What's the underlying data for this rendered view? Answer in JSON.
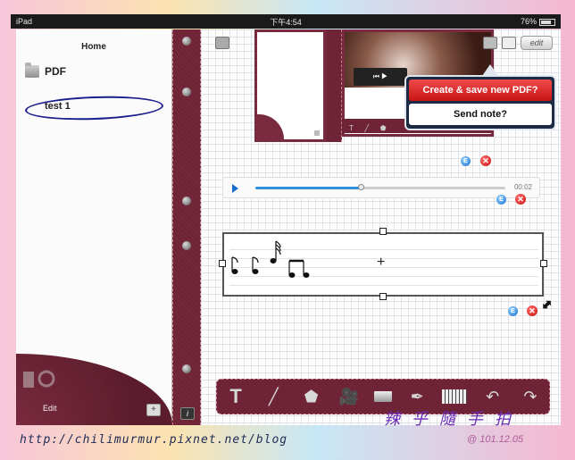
{
  "statusbar": {
    "device": "iPad",
    "time": "下午4:54",
    "battery": "76%"
  },
  "sidebar": {
    "title": "Home",
    "items": [
      {
        "label": "PDF",
        "type": "folder"
      },
      {
        "label": "test 1",
        "type": "note",
        "selected": true
      }
    ],
    "footer": {
      "edit_label": "Edit",
      "add_label": "+"
    }
  },
  "spine": {
    "info_label": "i"
  },
  "header": {
    "edit_label": "edit"
  },
  "popup": {
    "options": [
      {
        "label": "Create & save new PDF?"
      },
      {
        "label": "Send note?"
      }
    ]
  },
  "audio": {
    "time": "00:02",
    "progress": 0.42
  },
  "controls": {
    "edit_label": "E",
    "delete_label": "✕"
  },
  "toolbar": {
    "tools": [
      {
        "name": "text-tool",
        "glyph": "T"
      },
      {
        "name": "pen-tool",
        "glyph": "╱"
      },
      {
        "name": "shape-tool",
        "glyph": "⬟"
      },
      {
        "name": "video-tool",
        "glyph": "🎥"
      },
      {
        "name": "image-tool",
        "glyph": ""
      },
      {
        "name": "brush-tool",
        "glyph": "✒"
      },
      {
        "name": "music-tool",
        "glyph": ""
      },
      {
        "name": "undo-tool",
        "glyph": "↶"
      },
      {
        "name": "redo-tool",
        "glyph": "↷"
      }
    ]
  },
  "watermark": {
    "url": "http://chilimurmur.pixnet.net/blog",
    "signature": "辣 乎 隨 手 拍",
    "date": "@ 101.12.05"
  },
  "colors": {
    "leather": "#6e2436",
    "popup_red": "#d81c1c",
    "popup_bg": "#1d2a44",
    "audio_blue": "#2f8fd9"
  }
}
